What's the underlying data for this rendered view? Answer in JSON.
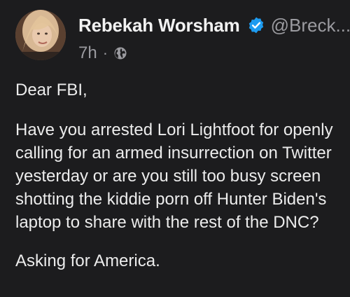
{
  "post": {
    "author_name": "Rebekah Worsham",
    "author_handle": "@Breck...",
    "timestamp": "7h",
    "separator": "·",
    "visibility_icon": "globe-icon",
    "verified_icon": "verified-badge-icon",
    "greeting": "Dear FBI,",
    "body": "Have you arrested Lori Lightfoot for openly calling for an armed insurrection on Twitter yesterday or are you still too busy screen shotting the kiddie porn off Hunter Biden's laptop to share with the rest of the DNC?",
    "closing": "Asking for America."
  },
  "colors": {
    "background": "#1c1c1e",
    "text_primary": "#ececec",
    "text_secondary": "#9b9ba0",
    "verified_blue": "#1d9bf0"
  }
}
